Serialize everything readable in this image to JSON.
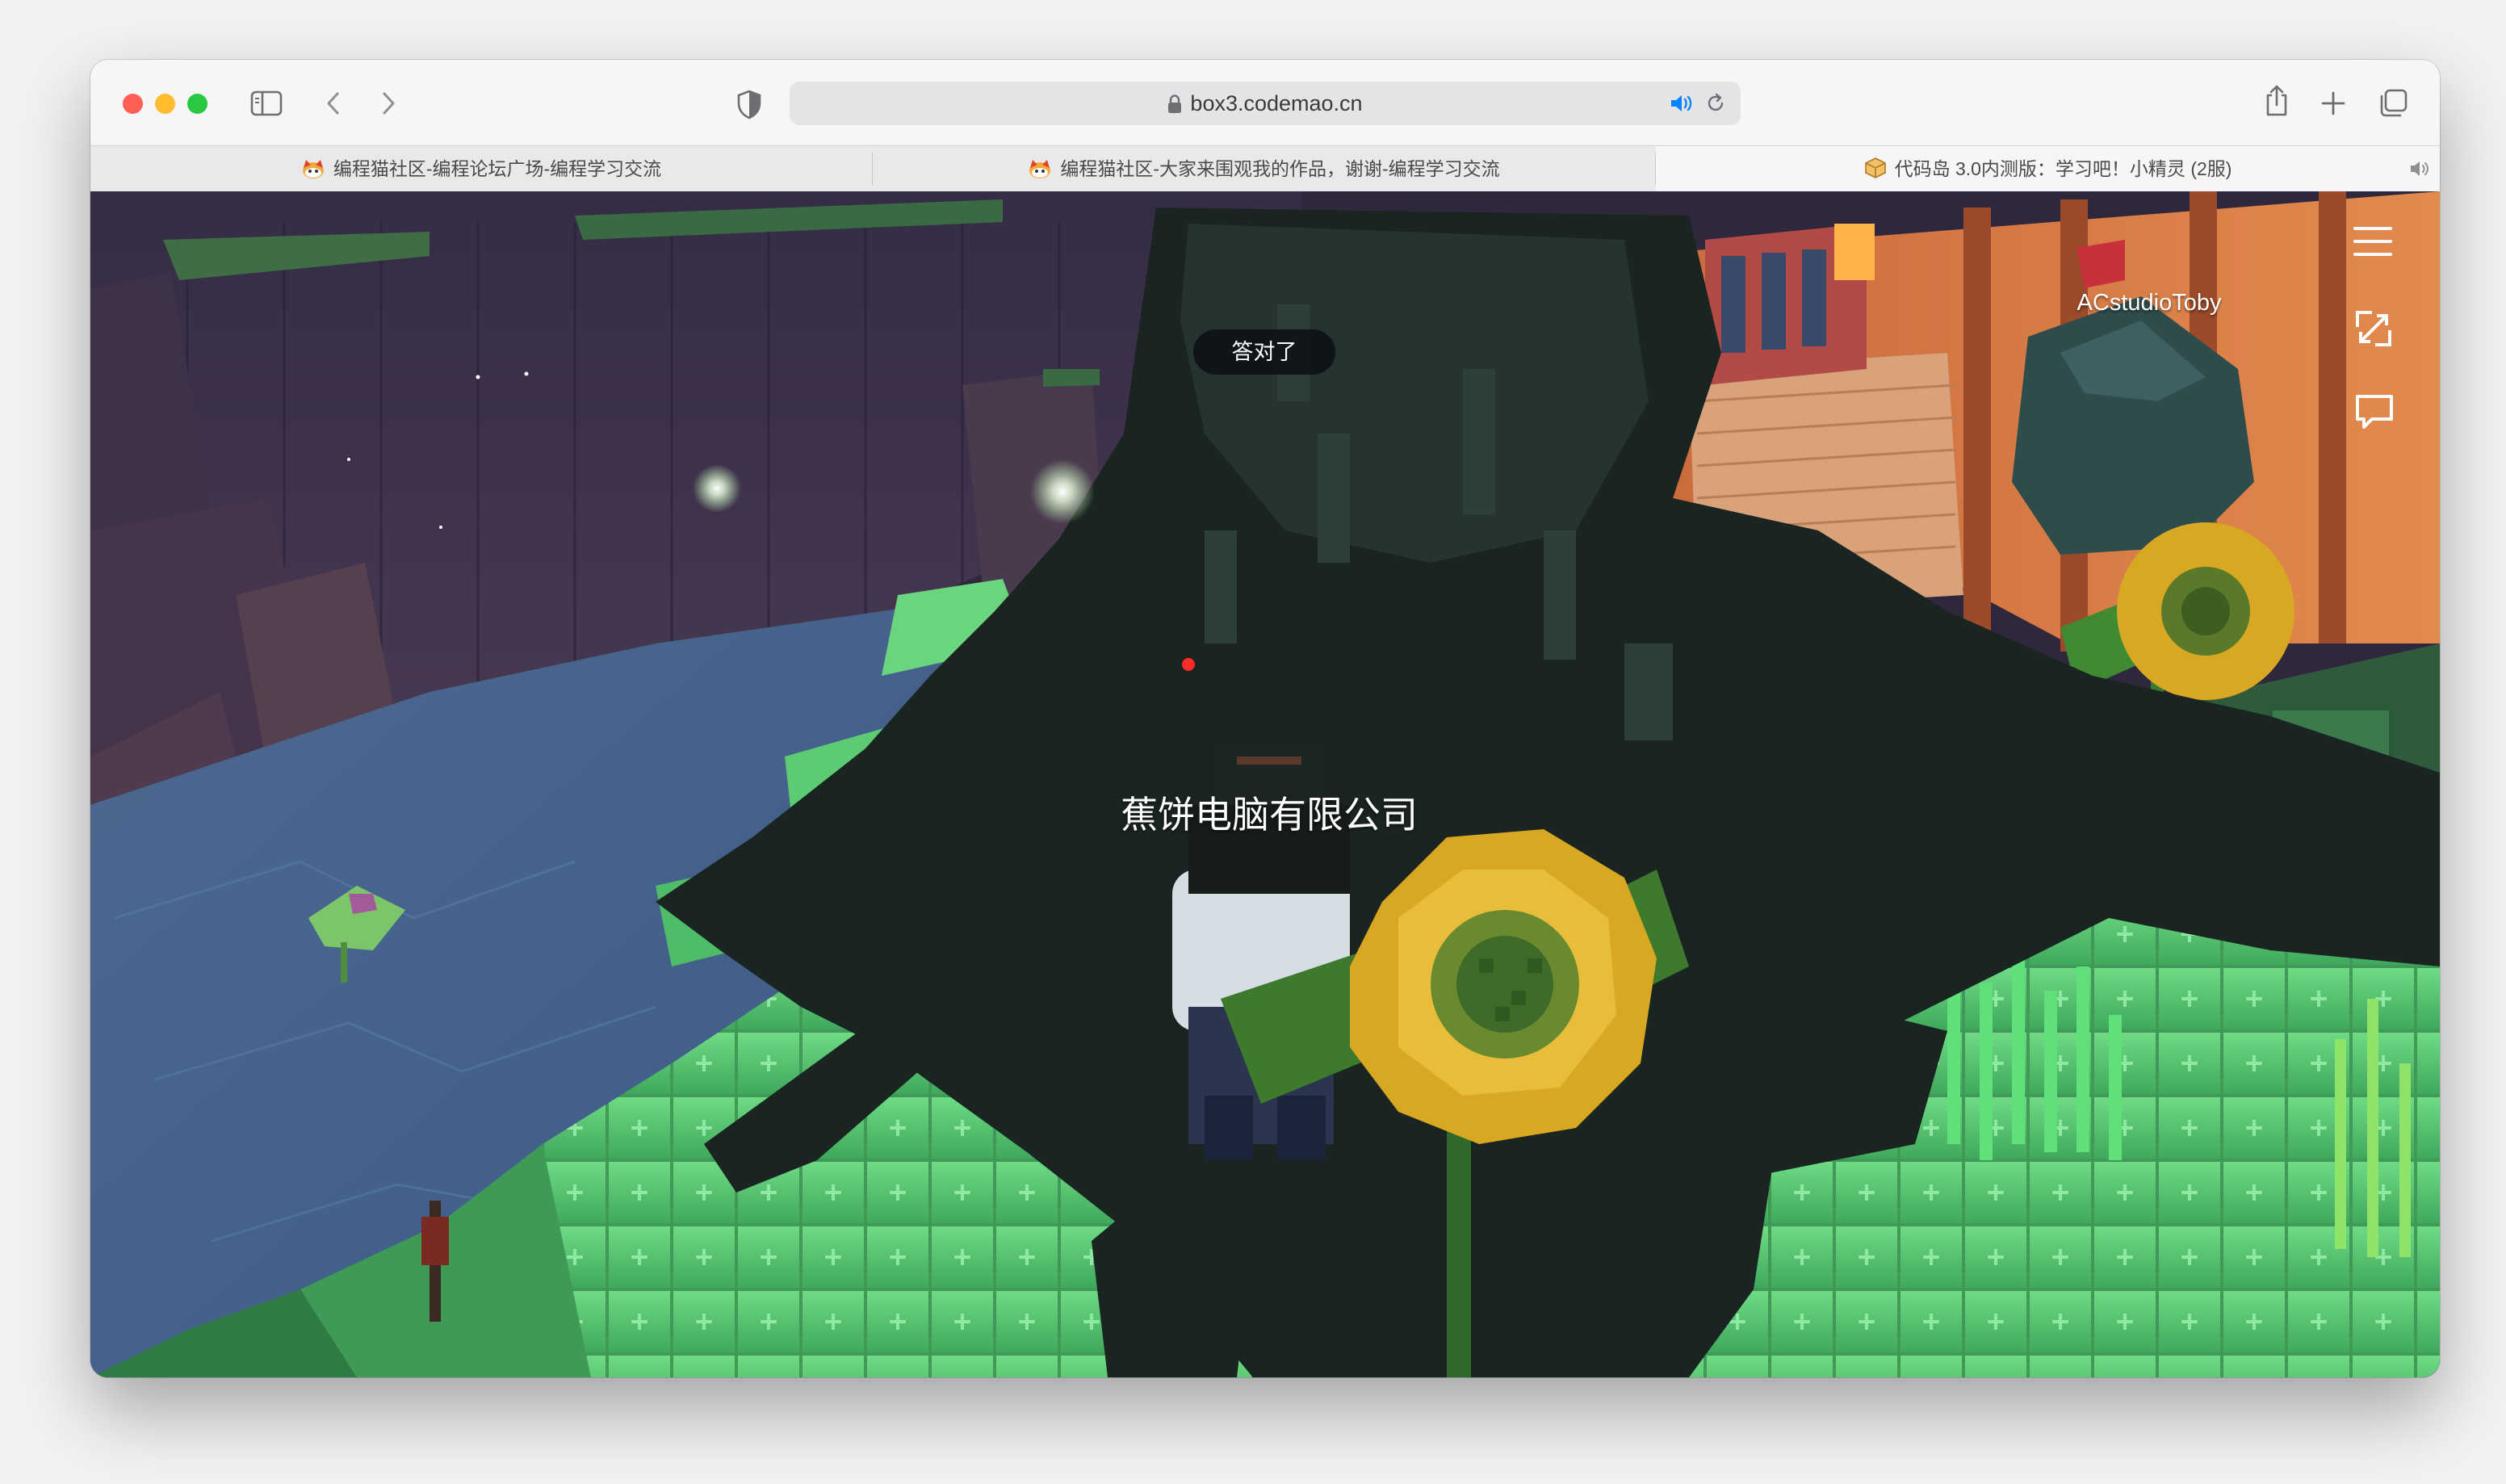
{
  "browser": {
    "url": "box3.codemao.cn",
    "tabs": [
      {
        "label": "编程猫社区-编程论坛广场-编程学习交流",
        "active": false
      },
      {
        "label": "编程猫社区-大家来围观我的作品，谢谢-编程学习交流",
        "active": false
      },
      {
        "label": "代码岛 3.0内测版：学习吧！小精灵 (2服)",
        "active": true
      }
    ],
    "icons": {
      "sidebar": "sidebar-icon",
      "back": "chevron-left-icon",
      "forward": "chevron-right-icon",
      "privacy": "shield-icon",
      "lock": "lock-icon",
      "audio": "speaker-icon",
      "reload": "reload-icon",
      "share": "share-icon",
      "new_tab": "plus-icon",
      "tabs_overview": "tabs-overview-icon"
    }
  },
  "game": {
    "toast": "答对了",
    "company_tag": "蕉饼电脑有限公司",
    "player_name": "ACstudioToby",
    "hud_icons": [
      "menu-icon",
      "fullscreen-icon",
      "chat-icon"
    ]
  },
  "colors": {
    "close": "#ff5f57",
    "minimize": "#febc2e",
    "maximize": "#28c840",
    "grass": "#5ed07a",
    "sunflower": "#d9a823",
    "shadow_blob": "#1a2420"
  }
}
